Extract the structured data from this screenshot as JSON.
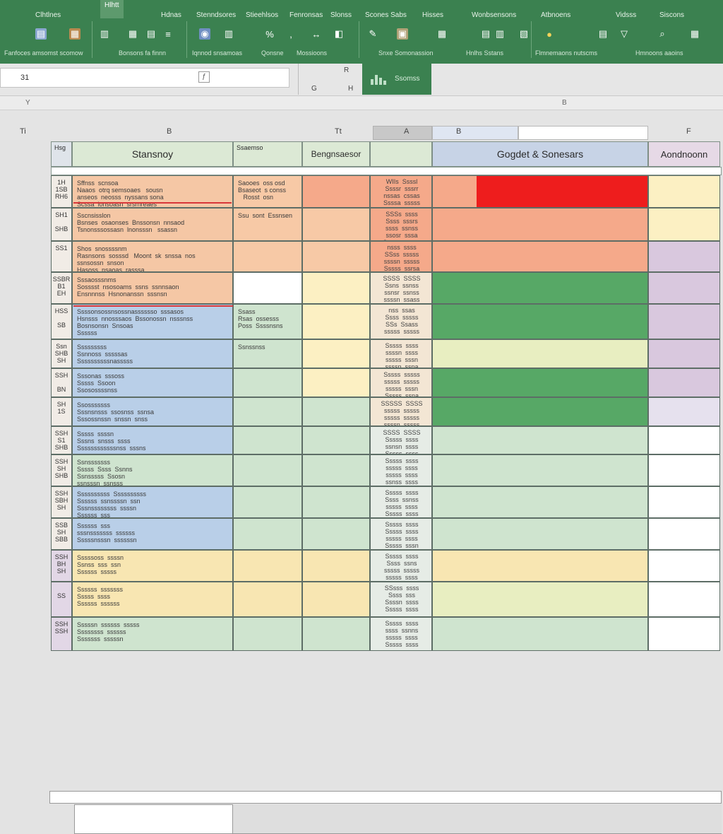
{
  "ribbon": {
    "tabs": [
      {
        "label": "Clhtlnes",
        "active": false
      },
      {
        "label": "Hlhtt",
        "active": true
      },
      {
        "label": "Hdnas",
        "active": false
      },
      {
        "label": "Stenndsores",
        "active": false
      },
      {
        "label": "Stieehlsos",
        "active": false
      },
      {
        "label": "Fenronsas",
        "active": false
      },
      {
        "label": "Slonss",
        "active": false
      },
      {
        "label": "Scones Sabs",
        "active": false
      },
      {
        "label": "Hisses",
        "active": false
      },
      {
        "label": "Wonbsensons",
        "active": false
      },
      {
        "label": "Atbnoens",
        "active": false
      },
      {
        "label": "Vidsss",
        "active": false
      },
      {
        "label": "Siscons",
        "active": false
      }
    ],
    "groups": [
      {
        "label": "Fanfoces amsomst scomow"
      },
      {
        "label": "Bonsons fa finnn"
      },
      {
        "label": "Iqnnod snsamoas"
      },
      {
        "label": "Qonsne"
      },
      {
        "label": "Mossioons"
      },
      {
        "label": "Snxe Somonassion"
      },
      {
        "label": "Hnlhs Sstans"
      },
      {
        "label": "Flmnemaons nutscms"
      },
      {
        "label": "Hmnoons aaoins"
      }
    ]
  },
  "formula": {
    "name_box_value": "31",
    "fx_top": "R",
    "fx_bottom_left": "G",
    "fx_bottom_right": "H",
    "green_label": "Ssomss"
  },
  "strip": {
    "left_mark": "Y",
    "right_mark": "B"
  },
  "columns": {
    "b": "B",
    "c": "Tt",
    "d": "A",
    "e": "B",
    "f": "F",
    "corner": "Ti"
  },
  "headers": {
    "id_col": "Hsg",
    "summary": "Stansnoy",
    "col_c": "Ssaemso",
    "categories": "Bengnsaesor",
    "scores": "Gogdet & Sonesars",
    "assignment": "Aondnoonn"
  },
  "colors": {
    "orange": "#f5c7a5",
    "peach": "#f7c9a6",
    "blue": "#b9cfe8",
    "yellow": "#f8e6b2",
    "light_yellow": "#fcf0c3",
    "green_dark": "#57a866",
    "green_light": "#cfe4cf",
    "lime": "#e8eec1",
    "red": "#ee1d1d",
    "salmon": "#f5a98a",
    "lavender": "#d9c8de",
    "white": "#ffffff",
    "pale_lavender": "#e6e1ee"
  },
  "rows": [
    {
      "id": "1H\n1SB\nRH6",
      "summary": "Sffnss  scnsoa\nNaaos  otrq semsoaes   sousn\nanseos  neosss  nyssans sona\nScssa  lonsoasn  srsrnreaes",
      "col_c": "Saooes  oss osd\nBsaseot  s conss\n   Rosst  osn",
      "scores": "WIIs  Ssssl\nSsssr  sssrr\nnssas  cssas\nSsssa  sssss\nSsstn  sssso"
    },
    {
      "id": "SH1\n\nSHB",
      "summary": "Sscnsisslon\nBsnses  osaonses  Bnssonsn  nnsaod\nTsnonsssossasn  lnonsssn   ssassn\n",
      "col_c": "Ssu  sont  Essnsen",
      "scores": "SSSs  ssss\nSsss  sssrs\nssss  ssnss\nssosr  sssa\nSssan  sssan"
    },
    {
      "id": "SS1\n\n",
      "summary": "Shos  snossssnm\nRasnsons  sosssd   Moont  sk  snssa  nos\nssnsossn  snson\nHasoss  nsaoas  rasssa",
      "col_c": "",
      "scores": "nsss  ssss\nSSss  sssss\nssssn  sssss\nSssss  ssrsa\nsssss  ssssa"
    },
    {
      "id": "SSBR\nB1\nEH",
      "summary": "Sssaosssnms\nSosssst  nsosoams  ssns  ssnnsaon\nEnsnnnss  Hsnonanssn  sssnsn\n",
      "col_c": "",
      "scores": "SSSS  SSSS\nSsns  ssnss\nssnsr  ssnss\nssssn  ssass"
    },
    {
      "id": "HSS\n\nSB",
      "summary": "Ssssonsossnsossnasssssso  sssasos\nHsnsss  nnosssaos  Bssonossn  nsssnss\nBosnsonsn  Snsoas\nSsssss",
      "col_c": "Ssass\nRsas  ossesss\nPoss  Ssssnsns",
      "scores": "nss  ssas\nSsss  sssss\nSSs  Ssass\nsssss  sssss"
    },
    {
      "id": "Ssn\nSHB\nSH",
      "summary": "Sssssssss\nSsnnoss  sssssas\nSsssssssssnasssss",
      "col_c": "Ssnssnss",
      "scores": "Sssss  ssss\nssssn  ssss\nsssss  sssn\nssssn  ssna"
    },
    {
      "id": "SSH\n\nBN",
      "summary": "Sssonas  sssoss\nSssss  Ssoon\nSsosossssnss",
      "col_c": "",
      "scores": "Sssss  sssss\nsssss  sssss\nsssss  sssn\nSssss  ssna"
    },
    {
      "id": "SH\n1S\n",
      "summary": "Ssosssssss\nSssnsnsss  ssosnss  ssnsa\nSssossnssn  snssn  snss",
      "col_c": "",
      "scores": "SSSSS  SSSS\nsssss  sssss\nsssss  sssss\nssssn  sssss"
    },
    {
      "id": "SSH\nS1\nSHB",
      "summary": "Sssss  ssssn\nSssns  snsss  ssss\nSsssssssssssnss  sssns",
      "col_c": "",
      "scores": "SSSS  SSSS\nSssss  ssss\nssnsn  ssss\nSssss  ssss"
    },
    {
      "id": "SSH\nSH\nSHB",
      "summary": "Ssnsssssss\nSssss  Ssss  Ssnns\nSsnsssss  Ssosn\nssnsssn  ssnsss",
      "col_c": "",
      "scores": "Sssss  ssss\nsssss  ssss\nsssss  ssss\nssnss  ssss"
    },
    {
      "id": "SSH\nSBH\nSH",
      "summary": "Ssssssssss  Ssssssssss\nSsssss  ssnssssn  ssn\nSssnssssssss  ssssn\nSsssss  sss",
      "col_c": "",
      "scores": "Sssss  ssss\nSsss  ssnss\nsssss  ssss\nSssss  ssss"
    },
    {
      "id": "SSB\nSH\nSBB",
      "summary": "Ssssss  sss\nsssnsssssss  ssssss\nSssssnsssn  ssssssn",
      "col_c": "",
      "scores": "Sssss  ssss\nSssss  ssss\nsssss  ssss\nSssss  sssn"
    },
    {
      "id": "SSH\nBH\nSH",
      "summary": "Sssssoss  ssssn\nSsnss  sss  ssn\nSsssss  sssss",
      "col_c": "",
      "scores": "Sssss  ssss\nSsss  ssns\nsssss  sssss\nsssss  ssss"
    },
    {
      "id": "\nSS\n",
      "summary": "Ssssss  sssssss\nSssss  ssss\nSsssss  ssssss",
      "col_c": "",
      "scores": "SSsss  ssss\nSsss  sss\nSsssn  ssss\nSssss  ssss"
    },
    {
      "id": "SSH\nSSH\n",
      "summary": "Sssssn  ssssss  sssss\nSsssssss  ssssss\nSssssss  sssssn",
      "col_c": "",
      "scores": "Sssss  ssss\nssss  ssnns\nsssss  ssss\nSssss  ssss"
    }
  ]
}
